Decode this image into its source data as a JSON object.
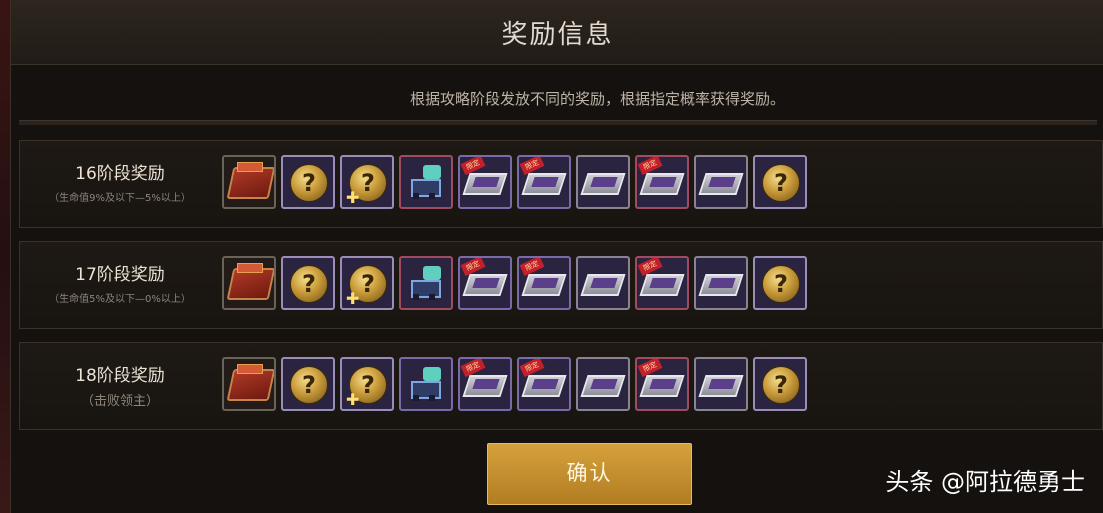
{
  "dialog": {
    "title": "奖励信息",
    "subtitle": "根据攻略阶段发放不同的奖励，根据指定概率获得奖励。",
    "confirm_label": "确认"
  },
  "stages": [
    {
      "name": "16阶段奖励",
      "condition": "（生命值9%及以下—5%以上）"
    },
    {
      "name": "17阶段奖励",
      "condition": "（生命值5%及以下—0%以上）"
    },
    {
      "name": "18阶段奖励",
      "condition": "（击败领主）"
    }
  ],
  "reward_icons": [
    "reward-case-icon",
    "mystery-orb-icon",
    "mystery-orb-plus-icon",
    "mech-creature-icon",
    "tagged-tray-icon",
    "tagged-tray-icon",
    "silver-tray-icon",
    "tagged-tray-icon",
    "silver-tray-icon",
    "mystery-orb-icon"
  ],
  "glyphs": {
    "question": "?",
    "plus": "✚",
    "tag": "限定"
  },
  "watermark": "头条 @阿拉德勇士",
  "colors": {
    "accent_gold": "#c89a38",
    "confirm_button": "#c48f2f",
    "panel_bg": "#15110e"
  }
}
